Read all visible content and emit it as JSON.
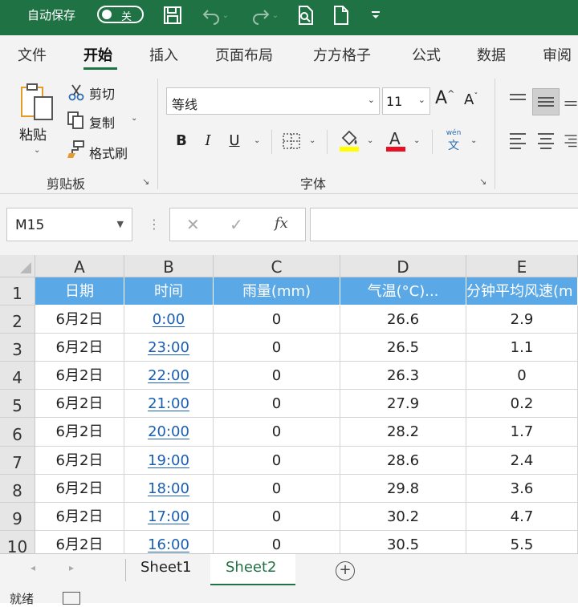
{
  "titlebar": {
    "autosave_label": "自动保存",
    "autosave_state": "关",
    "icons": [
      "save-icon",
      "undo-icon",
      "redo-icon",
      "print-preview-icon",
      "new-document-icon",
      "customize-toolbar-icon"
    ]
  },
  "ribbon_tabs": [
    "文件",
    "开始",
    "插入",
    "页面布局",
    "方方格子",
    "公式",
    "数据",
    "审阅"
  ],
  "active_tab": "开始",
  "clipboard": {
    "paste": "粘贴",
    "cut": "剪切",
    "copy": "复制",
    "format_painter": "格式刷",
    "group_label": "剪贴板"
  },
  "font": {
    "font_name": "等线",
    "font_size": "11",
    "bold": "B",
    "italic": "I",
    "underline": "U",
    "phonetic_top": "wén",
    "phonetic_bottom": "文",
    "group_label": "字体",
    "highlight_color": "#ffff00",
    "font_color": "#e81123"
  },
  "formula_bar": {
    "name_box": "M15",
    "cancel": "✕",
    "enter": "✓",
    "fx": "fx",
    "formula": ""
  },
  "grid": {
    "columns": [
      "A",
      "B",
      "C",
      "D",
      "E"
    ],
    "row_numbers": [
      "1",
      "2",
      "3",
      "4",
      "5",
      "6",
      "7",
      "8",
      "9",
      "10"
    ],
    "header_row": [
      "日期",
      "时间",
      "雨量(mm)",
      "气温(°C)...",
      "分钟平均风速(m"
    ],
    "rows": [
      [
        "6月2日",
        "0:00",
        "0",
        "26.6",
        "2.9"
      ],
      [
        "6月2日",
        "23:00",
        "0",
        "26.5",
        "1.1"
      ],
      [
        "6月2日",
        "22:00",
        "0",
        "26.3",
        "0"
      ],
      [
        "6月2日",
        "21:00",
        "0",
        "27.9",
        "0.2"
      ],
      [
        "6月2日",
        "20:00",
        "0",
        "28.2",
        "1.7"
      ],
      [
        "6月2日",
        "19:00",
        "0",
        "28.6",
        "2.4"
      ],
      [
        "6月2日",
        "18:00",
        "0",
        "29.8",
        "3.6"
      ],
      [
        "6月2日",
        "17:00",
        "0",
        "30.2",
        "4.7"
      ],
      [
        "6月2日",
        "16:00",
        "0",
        "30.5",
        "5.5"
      ]
    ],
    "header_color": "#5aa9e6",
    "link_color": "#1a5fb4"
  },
  "sheets": [
    "Sheet1",
    "Sheet2"
  ],
  "active_sheet": "Sheet2",
  "status": {
    "text": "就绪"
  },
  "colors": {
    "brand": "#1f7244"
  }
}
